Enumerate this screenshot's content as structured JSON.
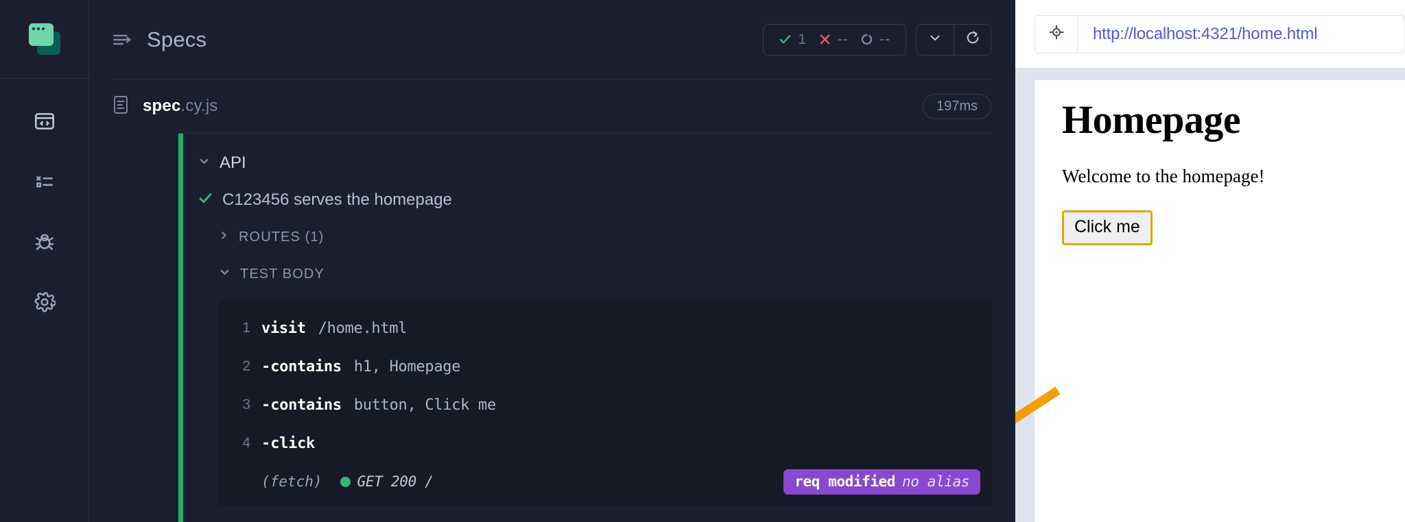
{
  "app": {
    "logo_name": "cypress-logo",
    "accent_green": "#21b16c",
    "badge_purple": "#8a47cf",
    "annotation_orange": "#f59e0b"
  },
  "sidebar": {
    "items": [
      {
        "icon": "specs-code-window-icon",
        "name": "sidebar-item-specs",
        "active": true
      },
      {
        "icon": "runs-list-icon",
        "name": "sidebar-item-runs",
        "active": false
      },
      {
        "icon": "debug-bug-icon",
        "name": "sidebar-item-debug",
        "active": false
      },
      {
        "icon": "settings-gear-icon",
        "name": "sidebar-item-settings",
        "active": false
      }
    ]
  },
  "reporter": {
    "title": "Specs",
    "stats": {
      "passed": {
        "label": "1",
        "icon": "check-icon",
        "color": "#2fb87b"
      },
      "failed": {
        "label": "--",
        "icon": "x-icon",
        "color": "#e45c6e"
      },
      "pending": {
        "label": "--",
        "icon": "pending-circle-icon",
        "color": "#7d859f"
      }
    },
    "toolbar": {
      "collapse_icon": "chevron-down-icon",
      "rerun_icon": "refresh-icon"
    },
    "spec": {
      "file_icon": "file-icon",
      "name_base": "spec",
      "name_ext": ".cy.js",
      "duration": "197ms"
    },
    "tree": {
      "suite": {
        "label": "API",
        "caret": "chevron-down-icon"
      },
      "test": {
        "label": "C123456 serves the homepage",
        "status_icon": "check-icon"
      },
      "sections": [
        {
          "label": "ROUTES (1)",
          "caret": "chevron-right-icon",
          "expanded": false
        },
        {
          "label": "TEST BODY",
          "caret": "chevron-down-icon",
          "expanded": true
        }
      ]
    },
    "commands": [
      {
        "num": "1",
        "dash": "",
        "name": "visit",
        "args": "/home.html"
      },
      {
        "num": "2",
        "dash": "-",
        "name": "contains",
        "args": "h1, Homepage"
      },
      {
        "num": "3",
        "dash": "-",
        "name": "contains",
        "args": "button, Click me"
      },
      {
        "num": "4",
        "dash": "-",
        "name": "click",
        "args": ""
      }
    ],
    "fetch_row": {
      "tag": "(fetch)",
      "status_dot_color": "#2fb87b",
      "status": "GET 200 /",
      "badge_main": "req modified",
      "badge_sub": "no alias"
    }
  },
  "aut": {
    "selector_icon": "selector-playground-crosshair-icon",
    "url": "http://localhost:4321/home.html",
    "page": {
      "heading": "Homepage",
      "paragraph": "Welcome to the homepage!",
      "button": "Click me"
    }
  }
}
